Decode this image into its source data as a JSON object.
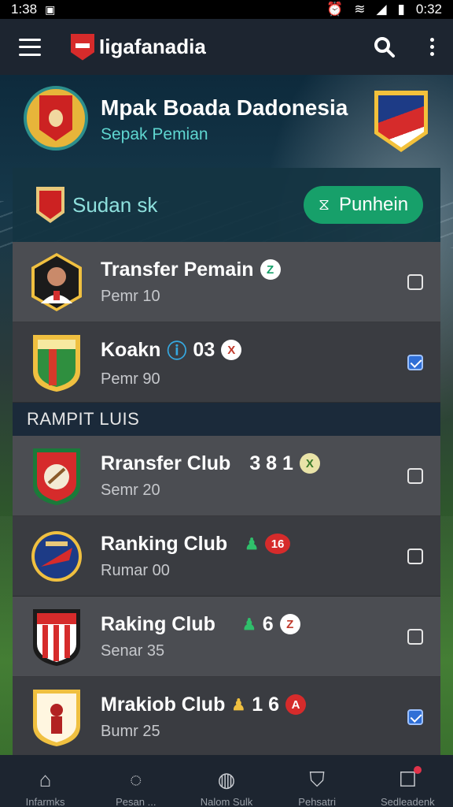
{
  "status_bar": {
    "time": "1:38",
    "battery_time": "0:32"
  },
  "app_bar": {
    "title": "Iigafanadia"
  },
  "header": {
    "title": "Mpak Boada Dadonesia",
    "subtitle": "Sepak Pemian"
  },
  "card": {
    "title": "Sudan sk",
    "action_label": "Punhein",
    "rows": [
      {
        "title": "Transfer Pemain",
        "meta": "",
        "tag": "Z",
        "sub": "Pemr 10",
        "checked": false
      },
      {
        "title": "Koakn",
        "meta": "03",
        "tag": "X",
        "sub": "Pemr 90",
        "checked": true
      }
    ],
    "section_label": "RAMPIT LUIS",
    "club_rows": [
      {
        "title": "Rransfer Club",
        "meta": "3 8 1",
        "tag": "X",
        "sub": "Semr 20",
        "checked": false
      },
      {
        "title": "Ranking Club",
        "meta": "",
        "tag": "16",
        "sub": "Rumar 00",
        "checked": false
      },
      {
        "title": "Raking Club",
        "meta": "6",
        "tag": "Z",
        "sub": "Senar 35",
        "checked": false
      },
      {
        "title": "Mrakiob Club",
        "meta": "1 6",
        "tag": "A",
        "sub": "Bumr 25",
        "checked": true
      }
    ]
  },
  "bottom_nav": [
    {
      "icon": "home-icon",
      "label": "Infarmks"
    },
    {
      "icon": "location-icon",
      "label": "Pesan ..."
    },
    {
      "icon": "bell-icon",
      "label": "Nalom Sulk"
    },
    {
      "icon": "shield-icon",
      "label": "Pehsatri"
    },
    {
      "icon": "notification-icon",
      "label": "Sedleadenk"
    }
  ],
  "colors": {
    "accent": "#17a06a",
    "header_subtitle": "#5fd6d0",
    "appbar": "#1d2530"
  }
}
